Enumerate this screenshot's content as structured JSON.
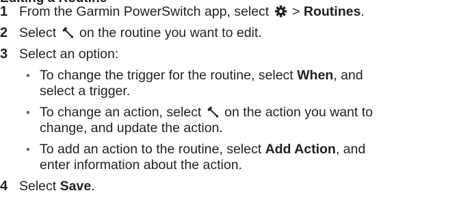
{
  "partial_heading": "Editing a Routine",
  "steps": [
    {
      "number": "1",
      "before": "From the Garmin PowerSwitch app, select ",
      "icon": "gear-icon",
      "between": " > ",
      "bold": "Routines",
      "after": "."
    },
    {
      "number": "2",
      "before": "Select ",
      "icon": "wrench-icon",
      "after": " on the routine you want to edit."
    },
    {
      "number": "3",
      "text": "Select an option:"
    },
    {
      "number": "4",
      "before": "Select ",
      "bold": "Save",
      "after": "."
    }
  ],
  "options": [
    {
      "line1_before": "To change the trigger for the routine, select ",
      "line1_bold": "When",
      "line1_after": ", and",
      "line2": "select a trigger."
    },
    {
      "line1_before": "To change an action, select ",
      "icon": "wrench-icon",
      "line1_after": " on the action you want to",
      "line2": "change, and update the action."
    },
    {
      "line1_before": "To add an action to the routine, select ",
      "line1_bold": "Add Action",
      "line1_after": ", and",
      "line2": "enter information about the action."
    }
  ],
  "bullet_glyph": "•",
  "colors": {
    "text": "#231f20",
    "bullet": "#6d6e71"
  }
}
